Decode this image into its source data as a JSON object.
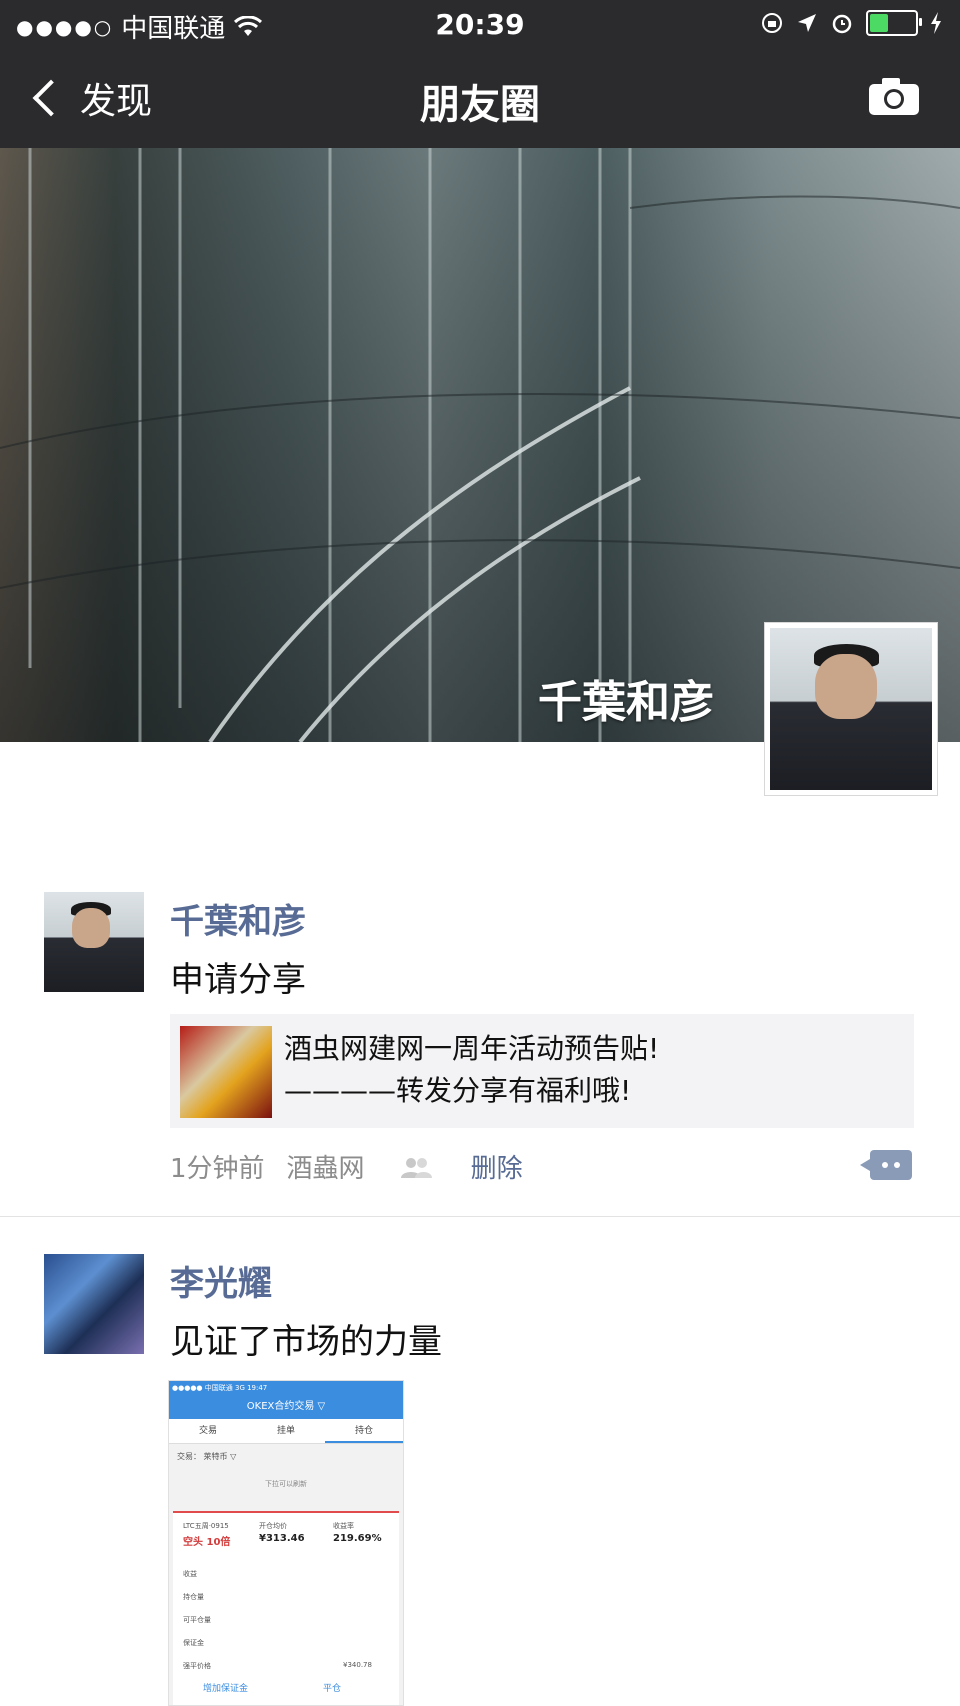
{
  "status_bar": {
    "signal": "●●●●○",
    "carrier": "中国联通",
    "time": "20:39"
  },
  "nav": {
    "back_label": "发现",
    "title": "朋友圈"
  },
  "cover": {
    "name": "千葉和彦"
  },
  "posts": [
    {
      "author": "千葉和彦",
      "text": "申请分享",
      "link_line1": "酒虫网建网一周年活动预告贴!",
      "link_line2": "————转发分享有福利哦!",
      "time": "1分钟前",
      "source": "酒蟲网",
      "delete_label": "删除"
    },
    {
      "author": "李光耀",
      "text": "见证了市场的力量",
      "image": {
        "status": "●●●●● 中国联通  3G        19:47",
        "header": "OKEX合约交易 ▽",
        "tabs": [
          "交易",
          "挂单",
          "持仓"
        ],
        "filter": "交易：  莱特币  ▽",
        "hint": "下拉可以刷新",
        "contract": "LTC五周·0915",
        "avg_price_label": "开仓均价",
        "roe_label": "收益率",
        "position": "空头 10倍",
        "avg_price": "¥313.46",
        "roe": "219.69%",
        "rows": [
          "收益",
          "持仓量",
          "可平仓量",
          "保证金",
          "强平价格"
        ],
        "liq_price": "¥340.78",
        "add_margin": "增加保证金",
        "close": "平仓"
      }
    }
  ]
}
